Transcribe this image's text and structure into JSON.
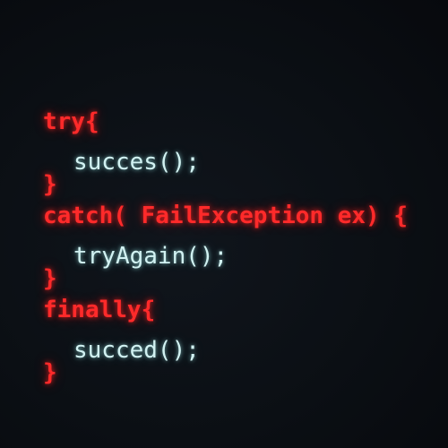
{
  "code_lines": [
    "try{",
    "succes();",
    "}",
    "catch( FailException ex) {",
    "tryAgain();",
    "}",
    "finally{",
    "succed();",
    "}"
  ],
  "colors": {
    "background": "#0a0d12",
    "keyword": "#ff2a2a",
    "body_text": "#d2f2f2"
  }
}
